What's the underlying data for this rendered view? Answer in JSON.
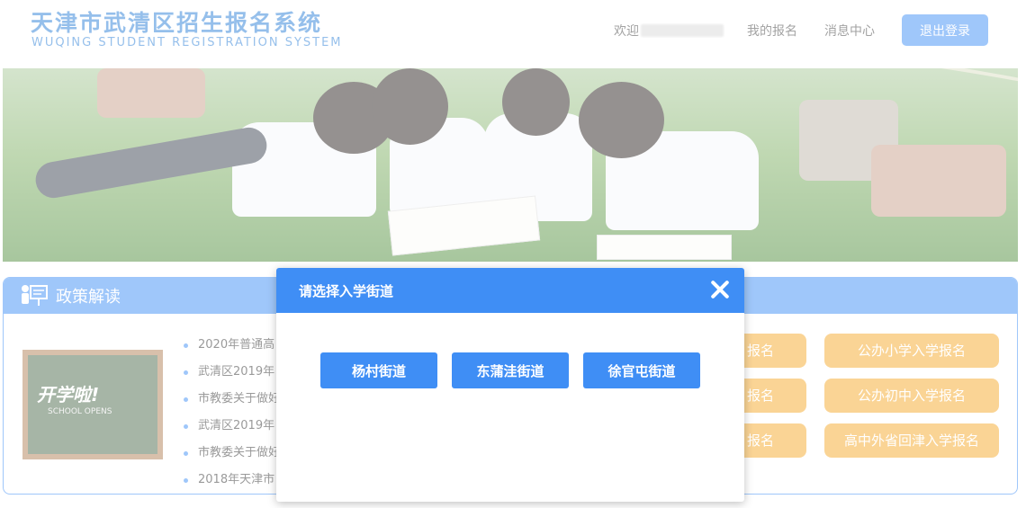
{
  "header": {
    "title_cn": "天津市武清区招生报名系统",
    "title_en": "WUQING STUDENT REGISTRATION SYSTEM",
    "welcome": "欢迎",
    "nav_my_registration": "我的报名",
    "nav_messages": "消息中心",
    "logout_label": "退出登录"
  },
  "policy": {
    "title": "政策解读",
    "image_text": "开学啦!",
    "image_subtext": "SCHOOL OPENS",
    "news": [
      "2020年普通高",
      "武清区2019年",
      "市教委关于做好",
      "武清区2019年",
      "市教委关于做好",
      "2018年天津市"
    ],
    "buttons_left": [
      "报名",
      "报名",
      "报名"
    ],
    "buttons_right": [
      "公办小学入学报名",
      "公办初中入学报名",
      "高中外省回津入学报名"
    ]
  },
  "modal": {
    "title": "请选择入学街道",
    "options": [
      "杨村街道",
      "东蒲洼街道",
      "徐官屯街道"
    ]
  },
  "colors": {
    "primary": "#3f8ef5",
    "accent_orange": "#f4a92b",
    "brand_blue": "#2b7fd6"
  }
}
